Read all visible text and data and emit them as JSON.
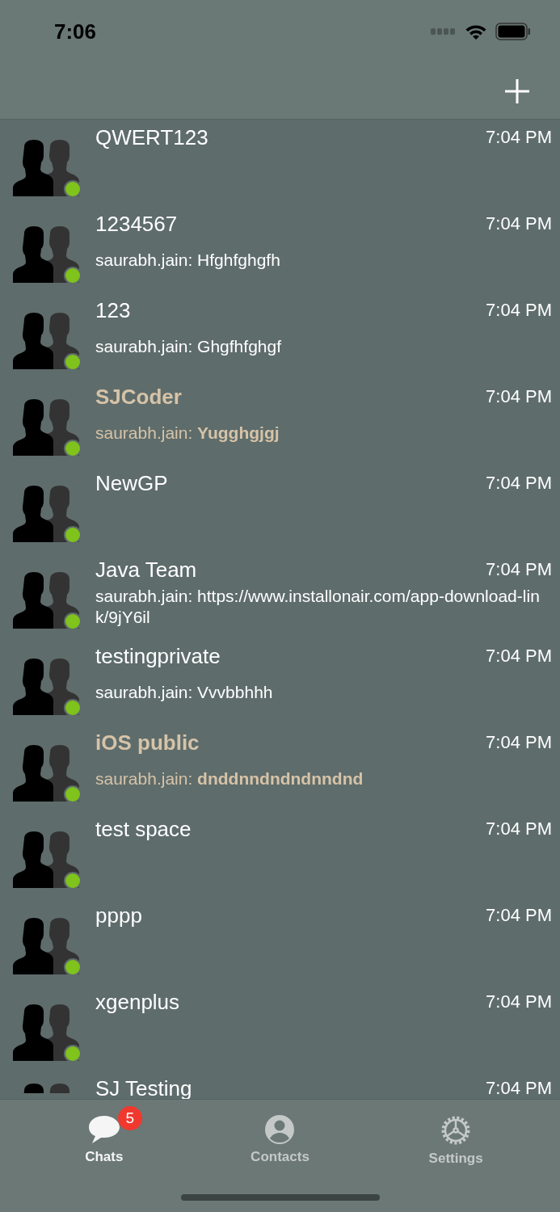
{
  "status_bar": {
    "time": "7:06"
  },
  "chats": [
    {
      "name": "QWERT123",
      "time": "7:04 PM",
      "unread": false,
      "online": true
    },
    {
      "name": "1234567",
      "time": "7:04 PM",
      "unread": false,
      "online": true,
      "sender": "saurabh.jain:",
      "message": "Hfghfghgfh"
    },
    {
      "name": "123",
      "time": "7:04 PM",
      "unread": false,
      "online": true,
      "sender": "saurabh.jain:",
      "message": "Ghgfhfghgf"
    },
    {
      "name": "SJCoder",
      "time": "7:04 PM",
      "unread": true,
      "online": true,
      "sender": "saurabh.jain:",
      "message": "Yugghgjgj"
    },
    {
      "name": "NewGP",
      "time": "7:04 PM",
      "unread": false,
      "online": true
    },
    {
      "name": "Java Team",
      "time": "7:04 PM",
      "unread": false,
      "online": true,
      "sender": "saurabh.jain:",
      "message": "https://www.installonair.com/app-download-link/9jY6il"
    },
    {
      "name": "testingprivate",
      "time": "7:04 PM",
      "unread": false,
      "online": true,
      "sender": "saurabh.jain:",
      "message": "Vvvbbhhh"
    },
    {
      "name": "iOS public",
      "time": "7:04 PM",
      "unread": true,
      "online": true,
      "sender": "saurabh.jain:",
      "message": "dnddnndndndnndnd"
    },
    {
      "name": "test space",
      "time": "7:04 PM",
      "unread": false,
      "online": true
    },
    {
      "name": "pppp",
      "time": "7:04 PM",
      "unread": false,
      "online": true
    },
    {
      "name": "xgenplus",
      "time": "7:04 PM",
      "unread": false,
      "online": true
    },
    {
      "name": "SJ Testing",
      "time": "7:04 PM",
      "unread": false
    }
  ],
  "tabs": [
    {
      "kind": "chats",
      "label": "Chats",
      "selected": true,
      "badge": "5"
    },
    {
      "kind": "contacts",
      "label": "Contacts",
      "selected": false
    },
    {
      "kind": "settings",
      "label": "Settings",
      "selected": false
    }
  ]
}
